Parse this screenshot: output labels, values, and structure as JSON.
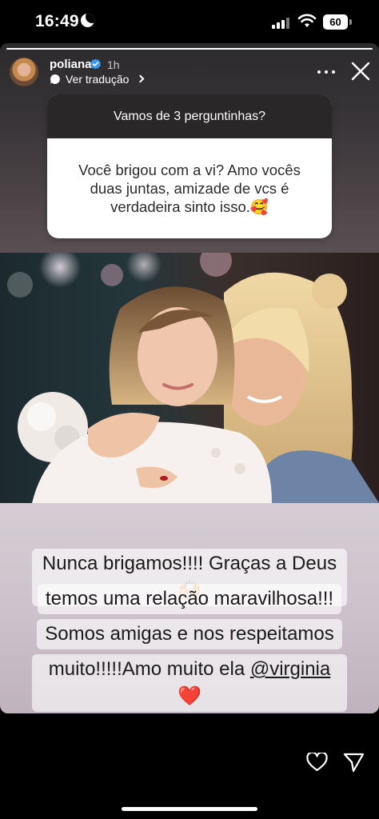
{
  "status_bar": {
    "time": "16:49",
    "battery": "60"
  },
  "story": {
    "progress": 1.0,
    "author": {
      "username": "poliana",
      "verified": true,
      "time_ago": "1h"
    },
    "translate_label": "Ver tradução",
    "question": {
      "header": "Vamos de 3 perguntinhas?",
      "body": "Você brigou com a vi? Amo vocês duas juntas, amizade de vcs é verdadeira sinto isso.🥰"
    },
    "answer": {
      "line1": "Nunca brigamos!!!! Graças a Deus🙌🏻",
      "line2": "temos uma relação maravilhosa!!!",
      "line3": "Somos amigas e nos respeitamos",
      "line4_text": "muito!!!!!Amo muito ela",
      "mention": "@virginia",
      "heart": "❤️"
    }
  },
  "icons": {
    "moon": "moon-icon",
    "signal": "cellular-signal-icon",
    "wifi": "wifi-icon",
    "battery": "battery-icon",
    "verified": "verified-badge-icon",
    "translate": "translate-bubble-icon",
    "chevron": "chevron-right-icon",
    "more": "more-horizontal-icon",
    "close": "close-icon",
    "like": "heart-icon",
    "share": "send-icon"
  },
  "colors": {
    "verified": "#3897f0",
    "heart": "#e0202a"
  }
}
